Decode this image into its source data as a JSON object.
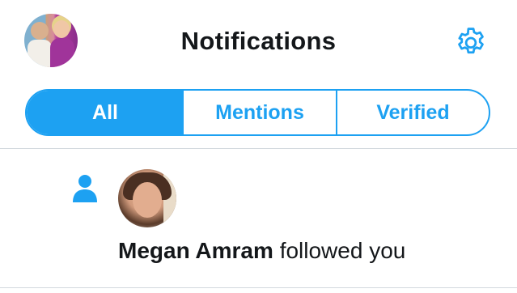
{
  "header": {
    "title": "Notifications",
    "avatar_icon": "profile-avatar",
    "settings_icon": "gear-icon"
  },
  "tabs": [
    {
      "label": "All",
      "active": true
    },
    {
      "label": "Mentions",
      "active": false
    },
    {
      "label": "Verified",
      "active": false
    }
  ],
  "notifications": [
    {
      "icon": "person-icon",
      "user_name": "Megan Amram",
      "action": "followed you"
    }
  ],
  "colors": {
    "accent": "#1da1f2",
    "text": "#14171a",
    "divider": "#d3d9de"
  }
}
